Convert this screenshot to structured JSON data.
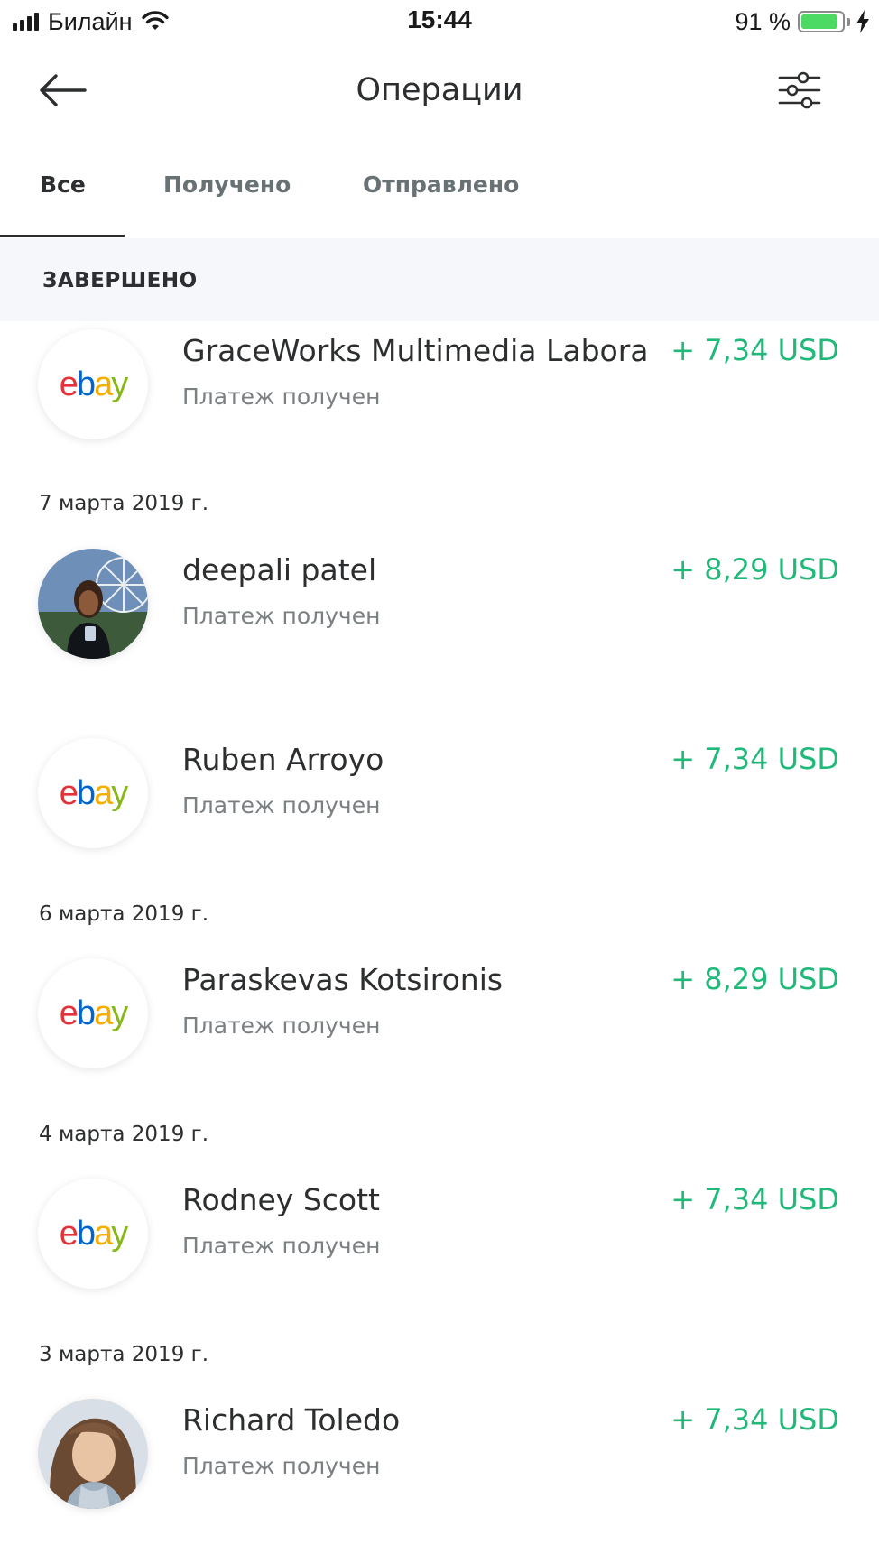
{
  "status_bar": {
    "carrier": "Билайн",
    "time": "15:44",
    "battery_percent": "91 %",
    "battery_level": 0.91,
    "signal_bars": 4,
    "wifi": true,
    "charging": true
  },
  "header": {
    "title": "Операции",
    "back_icon": "arrow-left-icon",
    "filter_icon": "sliders-icon"
  },
  "tabs": [
    {
      "label": "Все",
      "active": true
    },
    {
      "label": "Получено",
      "active": false
    },
    {
      "label": "Отправлено",
      "active": false
    }
  ],
  "section": {
    "label": "ЗАВЕРШЕНО"
  },
  "dates": [
    "7 марта 2019 г.",
    "6 марта 2019 г.",
    "4 марта 2019 г.",
    "3 марта 2019 г."
  ],
  "transactions": [
    {
      "name": "GraceWorks Multimedia Labora…",
      "status": "Платеж получен",
      "amount": "+ 7,34 USD",
      "avatar": "ebay-logo"
    },
    {
      "name": "deepali patel",
      "status": "Платеж получен",
      "amount": "+ 8,29 USD",
      "avatar": "user-photo"
    },
    {
      "name": "Ruben Arroyo",
      "status": "Платеж получен",
      "amount": "+ 7,34 USD",
      "avatar": "ebay-logo"
    },
    {
      "name": "Paraskevas Kotsironis",
      "status": "Платеж получен",
      "amount": "+ 8,29 USD",
      "avatar": "ebay-logo"
    },
    {
      "name": "Rodney Scott",
      "status": "Платеж получен",
      "amount": "+ 7,34 USD",
      "avatar": "ebay-logo"
    },
    {
      "name": "Richard Toledo",
      "status": "Платеж получен",
      "amount": "+ 7,34 USD",
      "avatar": "user-photo"
    }
  ],
  "ebay_logo_text": "ebay",
  "colors": {
    "amount_positive": "#21b97a",
    "section_bg": "#f5f7fa",
    "battery_fill": "#4cd964"
  }
}
